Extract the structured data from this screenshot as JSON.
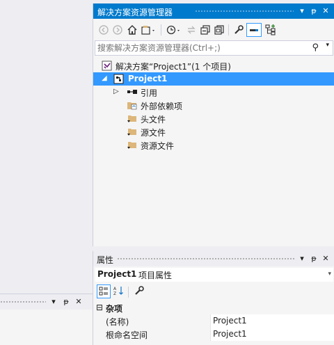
{
  "solution_explorer": {
    "title": "解决方案资源管理器",
    "search_placeholder": "搜索解决方案资源管理器(Ctrl+;)",
    "toolbar": [
      "back-icon",
      "forward-icon",
      "home-icon",
      "switch-views-icon",
      "pending-changes-icon",
      "sync-icon",
      "collapse-all-icon",
      "show-all-files-icon",
      "properties-icon",
      "preview-icon",
      "view-class-icon"
    ],
    "tree": [
      {
        "label": "解决方案“Project1”(1 个项目)",
        "icon": "solution-icon",
        "depth": 0,
        "selected": false,
        "expander": ""
      },
      {
        "label": "Project1",
        "icon": "project-icon",
        "depth": 1,
        "selected": true,
        "expander": "◢"
      },
      {
        "label": "引用",
        "icon": "references-icon",
        "depth": 2,
        "selected": false,
        "expander": "▷"
      },
      {
        "label": "外部依赖项",
        "icon": "external-deps-icon",
        "depth": 2,
        "selected": false,
        "expander": ""
      },
      {
        "label": "头文件",
        "icon": "folder-icon",
        "depth": 2,
        "selected": false,
        "expander": ""
      },
      {
        "label": "源文件",
        "icon": "folder-icon",
        "depth": 2,
        "selected": false,
        "expander": ""
      },
      {
        "label": "资源文件",
        "icon": "folder-icon",
        "depth": 2,
        "selected": false,
        "expander": ""
      }
    ]
  },
  "properties": {
    "title": "属性",
    "object_name": "Project1",
    "object_type": "项目属性",
    "category": "杂项",
    "rows": [
      {
        "key": "(名称)",
        "value": "Project1"
      },
      {
        "key": "根命名空间",
        "value": "Project1"
      }
    ]
  },
  "colors": {
    "accent": "#007acc",
    "selection": "#3399ff",
    "panel_bg": "#f5f5f5",
    "chrome_bg": "#eeeef2",
    "folder": "#dcb67a"
  }
}
